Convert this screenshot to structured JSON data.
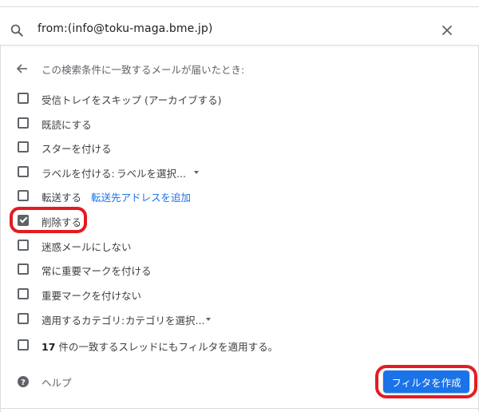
{
  "search": {
    "query": "from:(info@toku-maga.bme.jp)"
  },
  "header": {
    "back_label": "この検索条件に一致するメールが届いたとき:"
  },
  "options": [
    {
      "label": "受信トレイをスキップ (アーカイブする)",
      "checked": false
    },
    {
      "label": "既読にする",
      "checked": false
    },
    {
      "label": "スターを付ける",
      "checked": false
    },
    {
      "label": "ラベルを付ける:",
      "select": "ラベルを選択...",
      "checked": false
    },
    {
      "label": "転送する",
      "link": "転送先アドレスを追加",
      "checked": false
    },
    {
      "label": "削除する",
      "checked": true
    },
    {
      "label": "迷惑メールにしない",
      "checked": false
    },
    {
      "label": "常に重要マークを付ける",
      "checked": false
    },
    {
      "label": "重要マークを付けない",
      "checked": false
    },
    {
      "label": "適用するカテゴリ:",
      "select": "カテゴリを選択...",
      "checked": false
    },
    {
      "count": "17",
      "label": " 件の一致するスレッドにもフィルタを適用する。",
      "checked": false
    }
  ],
  "footer": {
    "help_label": "ヘルプ",
    "create_label": "フィルタを作成"
  },
  "colors": {
    "accent": "#1a73e8",
    "highlight": "#e31b23",
    "checkbox": "#5f6368"
  }
}
